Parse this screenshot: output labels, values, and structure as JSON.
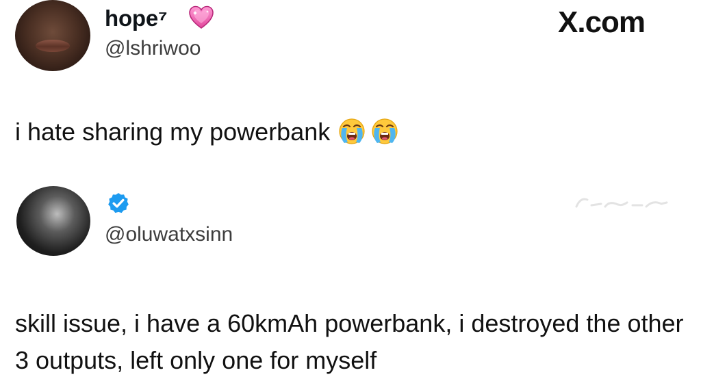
{
  "watermark_logo": "X.com",
  "post": {
    "display_name": "hope⁷",
    "name_icon": "sparkling-heart-icon",
    "handle": "@lshriwoo",
    "text": "i hate sharing my powerbank",
    "emojis": [
      "loudly-crying-face-icon",
      "loudly-crying-face-icon"
    ]
  },
  "reply": {
    "verified_icon": "verified-badge-icon",
    "handle": "@oluwatxsinn",
    "text": "skill issue, i have a 60kmAh powerbank, i destroyed the other 3 outputs, left only one for myself"
  },
  "colors": {
    "verified_blue": "#1d9bf0",
    "heart_pink": "#f06ab3",
    "text": "#111111",
    "handle_gray": "#3d3d3d",
    "background": "#ffffff"
  }
}
